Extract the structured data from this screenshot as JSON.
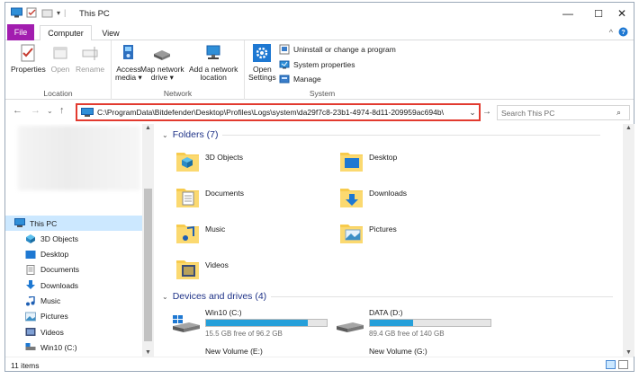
{
  "window": {
    "title": "This PC",
    "controls": {
      "minimize": "—",
      "maximize": "☐",
      "close": "✕"
    }
  },
  "ribbon": {
    "tabs": {
      "file": "File",
      "computer": "Computer",
      "view": "View"
    },
    "location": {
      "label": "Location",
      "properties": "Properties",
      "open": "Open",
      "rename": "Rename"
    },
    "network": {
      "label": "Network",
      "access_media_l1": "Access",
      "access_media_l2": "media ▾",
      "map_drive_l1": "Map network",
      "map_drive_l2": "drive ▾",
      "add_location_l1": "Add a network",
      "add_location_l2": "location"
    },
    "system": {
      "label": "System",
      "open_settings_l1": "Open",
      "open_settings_l2": "Settings",
      "uninstall": "Uninstall or change a program",
      "system_properties": "System properties",
      "manage": "Manage"
    }
  },
  "address": {
    "path": "C:\\ProgramData\\Bitdefender\\Desktop\\Profiles\\Logs\\system\\da29f7c8-23b1-4974-8d11-209959ac694b\\",
    "search_placeholder": "Search This PC"
  },
  "nav_pane": {
    "items": [
      {
        "label": "This PC",
        "icon": "pc-icon"
      },
      {
        "label": "3D Objects",
        "icon": "3d-objects-icon"
      },
      {
        "label": "Desktop",
        "icon": "desktop-folder-icon"
      },
      {
        "label": "Documents",
        "icon": "documents-icon"
      },
      {
        "label": "Downloads",
        "icon": "downloads-icon"
      },
      {
        "label": "Music",
        "icon": "music-icon"
      },
      {
        "label": "Pictures",
        "icon": "pictures-icon"
      },
      {
        "label": "Videos",
        "icon": "videos-icon"
      },
      {
        "label": "Win10 (C:)",
        "icon": "drive-icon"
      }
    ]
  },
  "content": {
    "folders_header": "Folders (7)",
    "folders": [
      {
        "name": "3D Objects"
      },
      {
        "name": "Desktop"
      },
      {
        "name": "Documents"
      },
      {
        "name": "Downloads"
      },
      {
        "name": "Music"
      },
      {
        "name": "Pictures"
      },
      {
        "name": "Videos"
      }
    ],
    "devices_header": "Devices and drives (4)",
    "drives": [
      {
        "name": "Win10 (C:)",
        "free": "15.5 GB free of 96.2 GB",
        "used_fraction": 0.84
      },
      {
        "name": "DATA (D:)",
        "free": "89.4 GB free of 140 GB",
        "used_fraction": 0.36
      }
    ],
    "drives_more": [
      {
        "name": "New Volume (E:)"
      },
      {
        "name": "New Volume (G:)"
      }
    ]
  },
  "status": {
    "items": "11 items"
  },
  "colors": {
    "accent": "#a21daf",
    "highlight": "#e23a2f",
    "selection": "#cce8ff",
    "drive_fill": "#26a0da"
  }
}
